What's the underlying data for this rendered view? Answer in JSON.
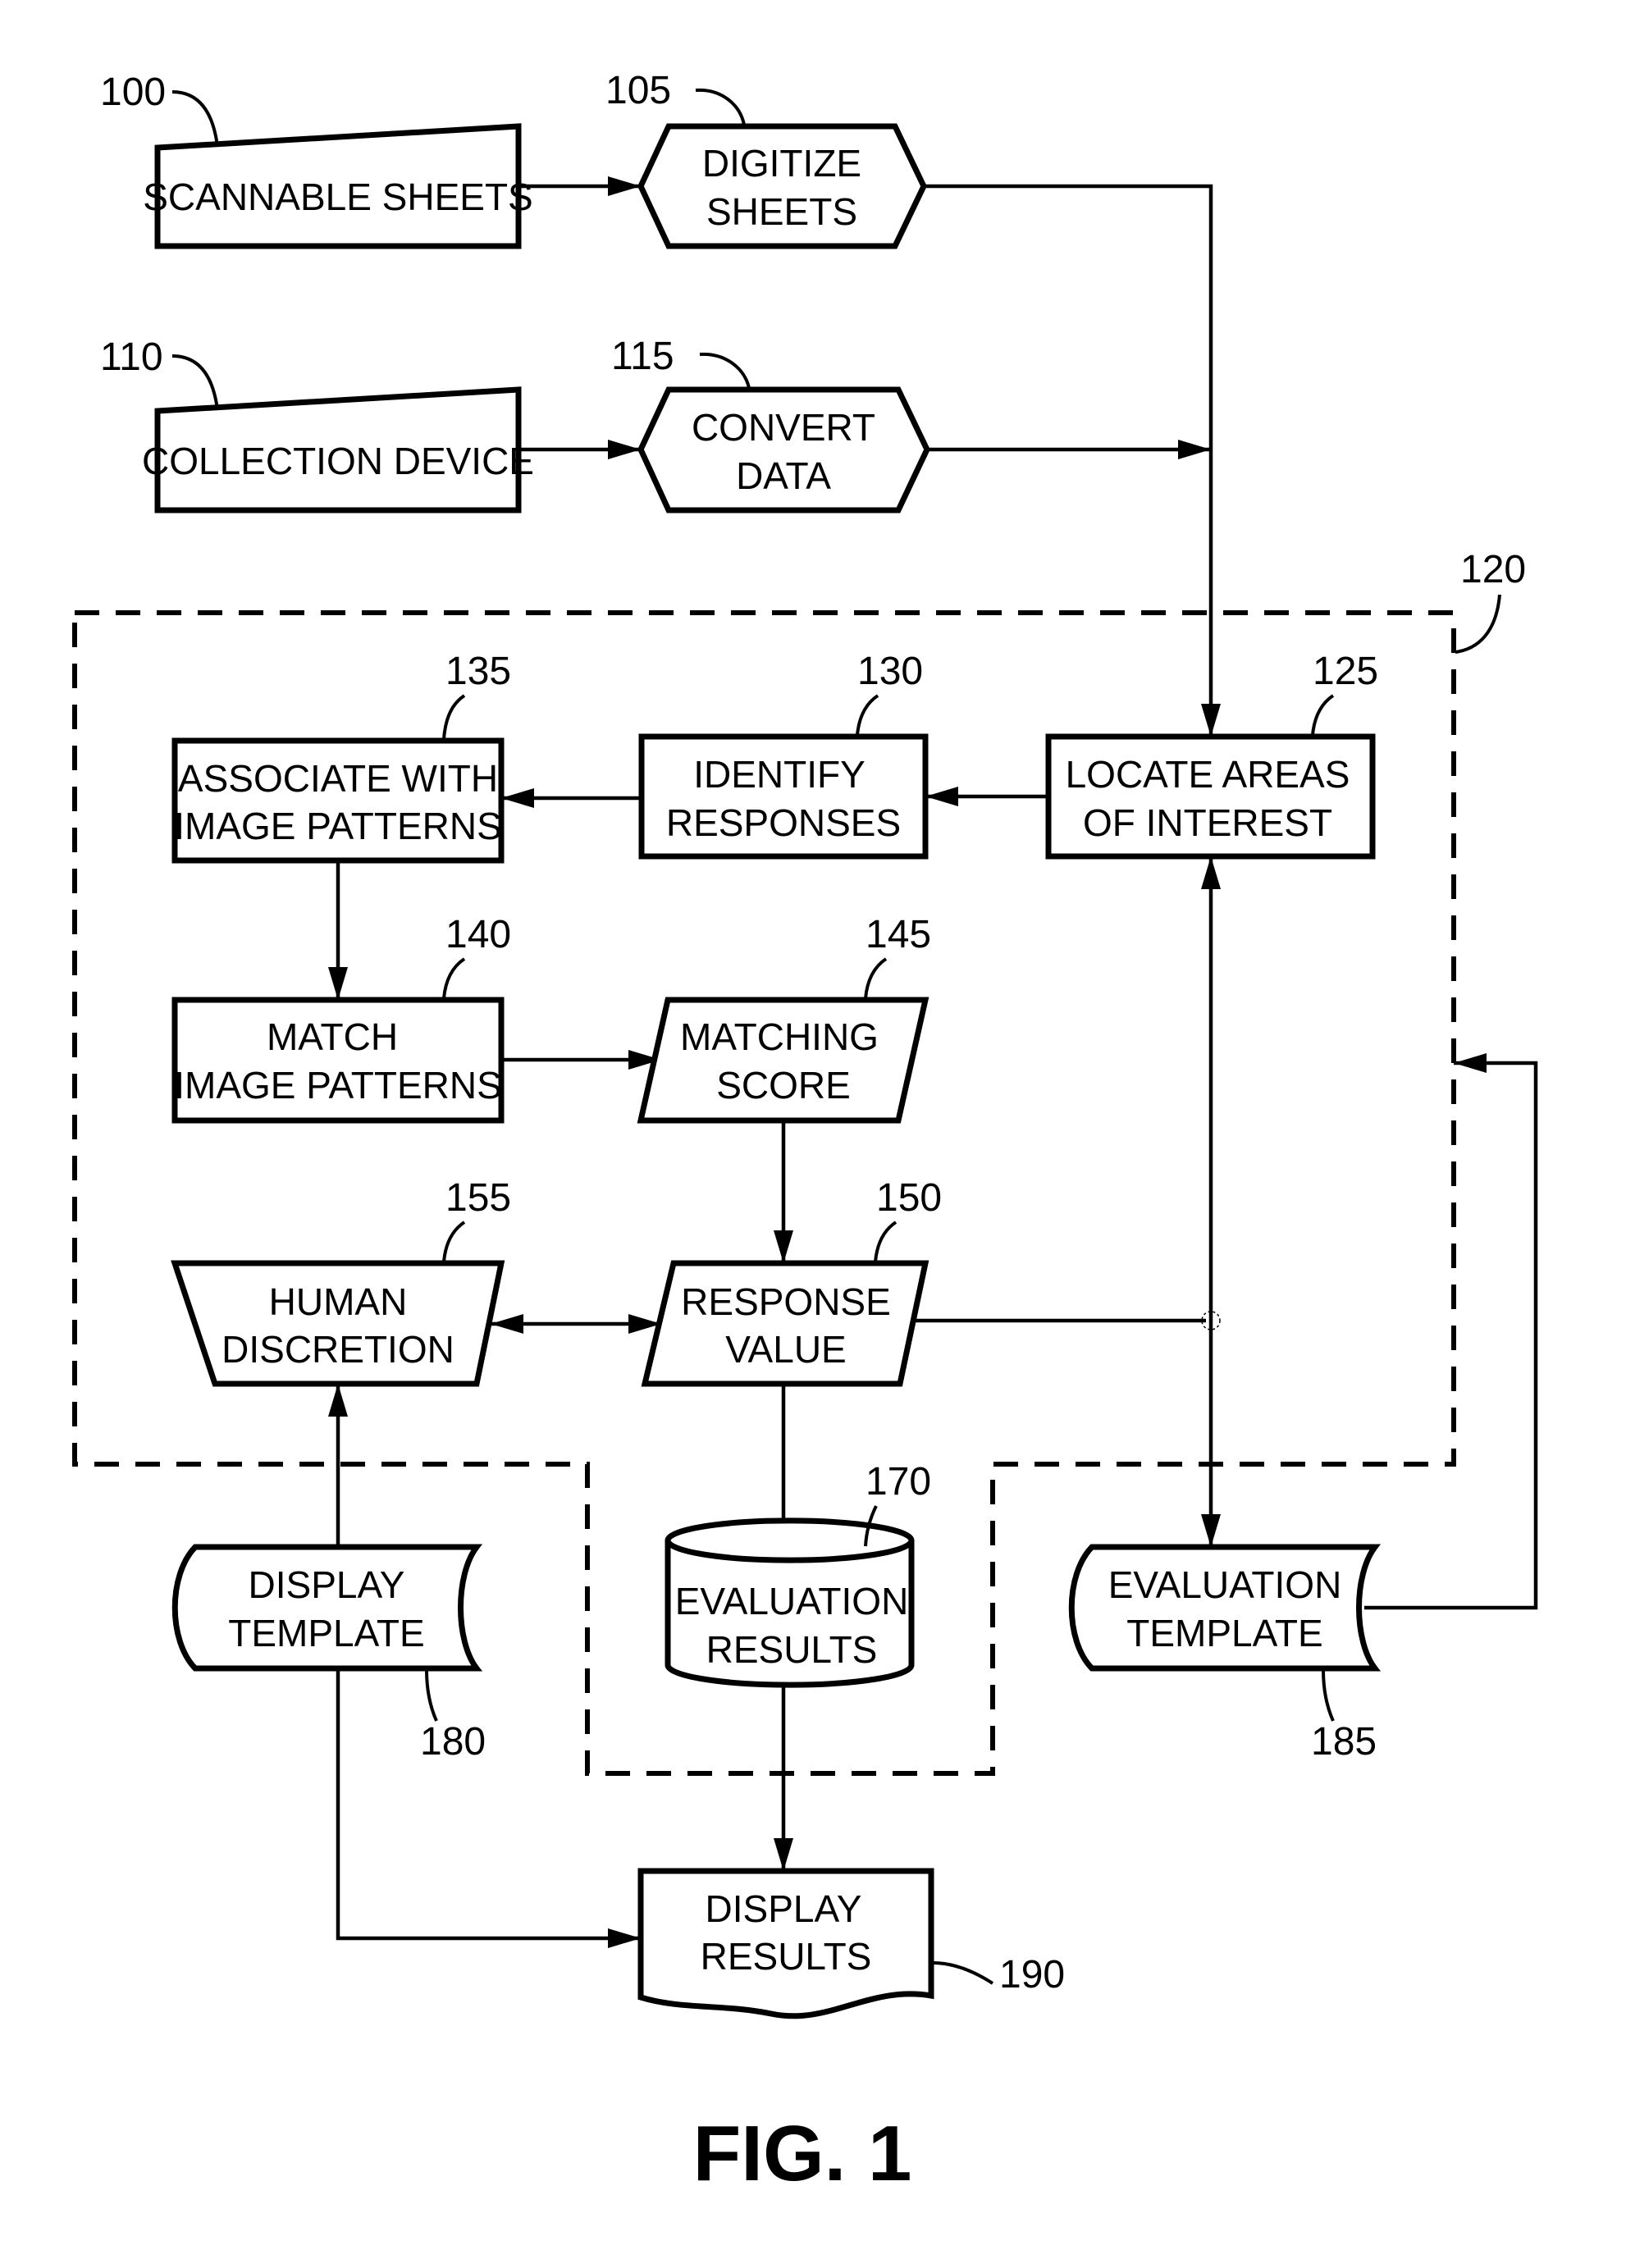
{
  "figure": {
    "caption": "FIG. 1",
    "system_ref": "120",
    "nodes": {
      "scannable_sheets": {
        "ref": "100",
        "line1": "SCANNABLE SHEETS"
      },
      "digitize_sheets": {
        "ref": "105",
        "line1": "DIGITIZE",
        "line2": "SHEETS"
      },
      "collection_device": {
        "ref": "110",
        "line1": "COLLECTION DEVICE"
      },
      "convert_data": {
        "ref": "115",
        "line1": "CONVERT",
        "line2": "DATA"
      },
      "locate_areas": {
        "ref": "125",
        "line1": "LOCATE AREAS",
        "line2": "OF INTEREST"
      },
      "identify_responses": {
        "ref": "130",
        "line1": "IDENTIFY",
        "line2": "RESPONSES"
      },
      "associate_patterns": {
        "ref": "135",
        "line1": "ASSOCIATE WITH",
        "line2": "IMAGE PATTERNS"
      },
      "match_patterns": {
        "ref": "140",
        "line1": "MATCH",
        "line2": "IMAGE PATTERNS"
      },
      "matching_score": {
        "ref": "145",
        "line1": "MATCHING",
        "line2": "SCORE"
      },
      "response_value": {
        "ref": "150",
        "line1": "RESPONSE",
        "line2": "VALUE"
      },
      "human_discretion": {
        "ref": "155",
        "line1": "HUMAN",
        "line2": "DISCRETION"
      },
      "evaluation_results": {
        "ref": "170",
        "line1": "EVALUATION",
        "line2": "RESULTS"
      },
      "display_template": {
        "ref": "180",
        "line1": "DISPLAY",
        "line2": "TEMPLATE"
      },
      "evaluation_template": {
        "ref": "185",
        "line1": "EVALUATION",
        "line2": "TEMPLATE"
      },
      "display_results": {
        "ref": "190",
        "line1": "DISPLAY",
        "line2": "RESULTS"
      }
    },
    "edges": [
      {
        "from": "100",
        "to": "105"
      },
      {
        "from": "110",
        "to": "115"
      },
      {
        "from": "105",
        "to": "125"
      },
      {
        "from": "115",
        "to": "125"
      },
      {
        "from": "125",
        "to": "130"
      },
      {
        "from": "130",
        "to": "135"
      },
      {
        "from": "135",
        "to": "140"
      },
      {
        "from": "140",
        "to": "145"
      },
      {
        "from": "145",
        "to": "150"
      },
      {
        "from": "150",
        "to": "155",
        "bidirectional": true
      },
      {
        "from": "150",
        "to": "170"
      },
      {
        "from": "125",
        "to": "185",
        "bidirectional": true
      },
      {
        "from": "185",
        "to": "120"
      },
      {
        "from": "180",
        "to": "155"
      },
      {
        "from": "180",
        "to": "190"
      },
      {
        "from": "170",
        "to": "190"
      }
    ]
  }
}
